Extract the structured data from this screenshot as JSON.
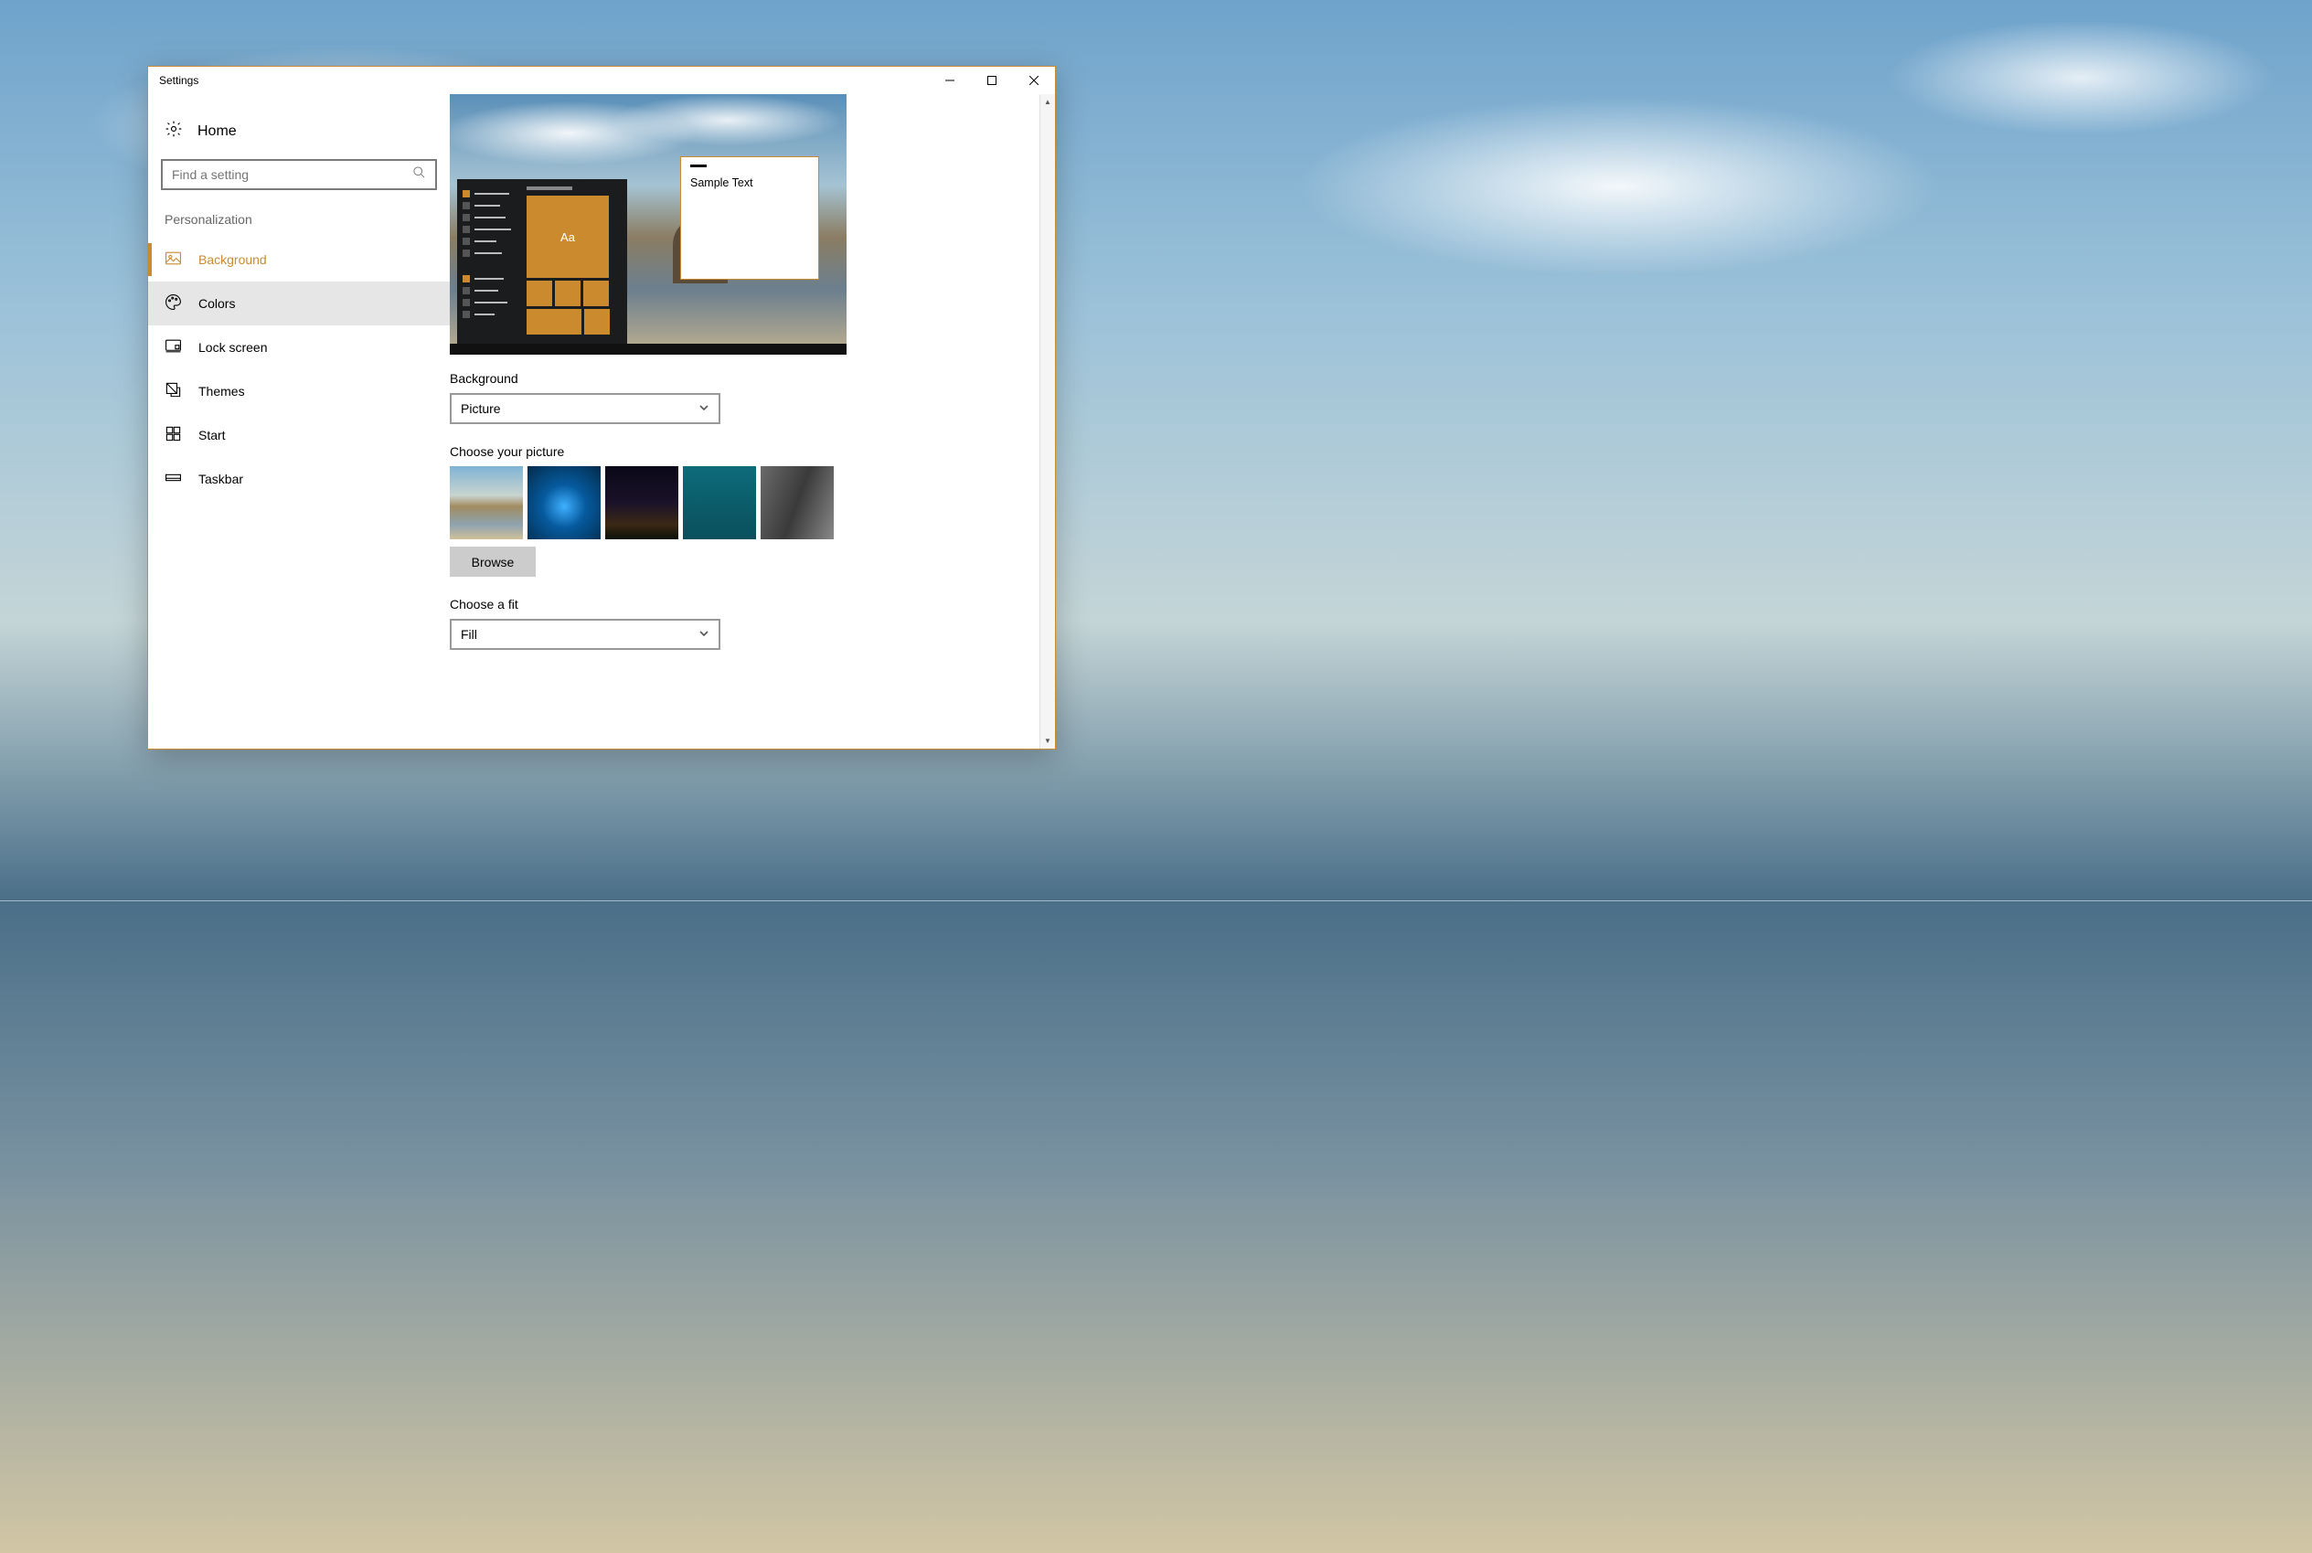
{
  "window": {
    "title": "Settings"
  },
  "sidebar": {
    "home_label": "Home",
    "search_placeholder": "Find a setting",
    "section_label": "Personalization",
    "items": [
      {
        "label": "Background"
      },
      {
        "label": "Colors"
      },
      {
        "label": "Lock screen"
      },
      {
        "label": "Themes"
      },
      {
        "label": "Start"
      },
      {
        "label": "Taskbar"
      }
    ]
  },
  "preview": {
    "tile_text": "Aa",
    "sample_text": "Sample Text"
  },
  "main": {
    "background_label": "Background",
    "background_value": "Picture",
    "choose_picture_label": "Choose your picture",
    "browse_label": "Browse",
    "choose_fit_label": "Choose a fit",
    "fit_value": "Fill"
  }
}
